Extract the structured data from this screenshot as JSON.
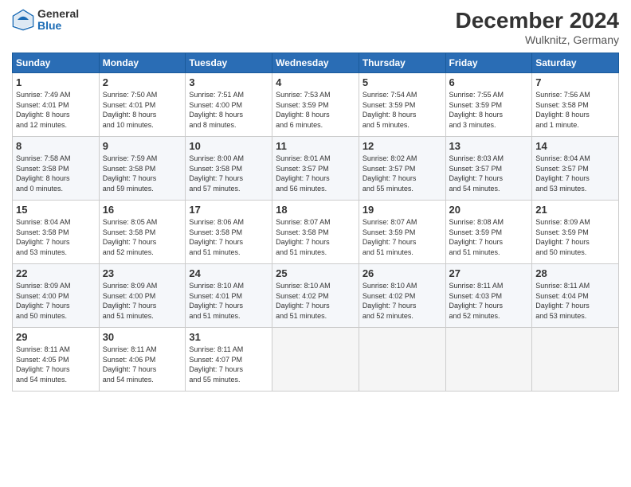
{
  "header": {
    "logo_general": "General",
    "logo_blue": "Blue",
    "month_title": "December 2024",
    "location": "Wulknitz, Germany"
  },
  "weekdays": [
    "Sunday",
    "Monday",
    "Tuesday",
    "Wednesday",
    "Thursday",
    "Friday",
    "Saturday"
  ],
  "weeks": [
    [
      {
        "day": "1",
        "info": "Sunrise: 7:49 AM\nSunset: 4:01 PM\nDaylight: 8 hours\nand 12 minutes."
      },
      {
        "day": "2",
        "info": "Sunrise: 7:50 AM\nSunset: 4:01 PM\nDaylight: 8 hours\nand 10 minutes."
      },
      {
        "day": "3",
        "info": "Sunrise: 7:51 AM\nSunset: 4:00 PM\nDaylight: 8 hours\nand 8 minutes."
      },
      {
        "day": "4",
        "info": "Sunrise: 7:53 AM\nSunset: 3:59 PM\nDaylight: 8 hours\nand 6 minutes."
      },
      {
        "day": "5",
        "info": "Sunrise: 7:54 AM\nSunset: 3:59 PM\nDaylight: 8 hours\nand 5 minutes."
      },
      {
        "day": "6",
        "info": "Sunrise: 7:55 AM\nSunset: 3:59 PM\nDaylight: 8 hours\nand 3 minutes."
      },
      {
        "day": "7",
        "info": "Sunrise: 7:56 AM\nSunset: 3:58 PM\nDaylight: 8 hours\nand 1 minute."
      }
    ],
    [
      {
        "day": "8",
        "info": "Sunrise: 7:58 AM\nSunset: 3:58 PM\nDaylight: 8 hours\nand 0 minutes."
      },
      {
        "day": "9",
        "info": "Sunrise: 7:59 AM\nSunset: 3:58 PM\nDaylight: 7 hours\nand 59 minutes."
      },
      {
        "day": "10",
        "info": "Sunrise: 8:00 AM\nSunset: 3:58 PM\nDaylight: 7 hours\nand 57 minutes."
      },
      {
        "day": "11",
        "info": "Sunrise: 8:01 AM\nSunset: 3:57 PM\nDaylight: 7 hours\nand 56 minutes."
      },
      {
        "day": "12",
        "info": "Sunrise: 8:02 AM\nSunset: 3:57 PM\nDaylight: 7 hours\nand 55 minutes."
      },
      {
        "day": "13",
        "info": "Sunrise: 8:03 AM\nSunset: 3:57 PM\nDaylight: 7 hours\nand 54 minutes."
      },
      {
        "day": "14",
        "info": "Sunrise: 8:04 AM\nSunset: 3:57 PM\nDaylight: 7 hours\nand 53 minutes."
      }
    ],
    [
      {
        "day": "15",
        "info": "Sunrise: 8:04 AM\nSunset: 3:58 PM\nDaylight: 7 hours\nand 53 minutes."
      },
      {
        "day": "16",
        "info": "Sunrise: 8:05 AM\nSunset: 3:58 PM\nDaylight: 7 hours\nand 52 minutes."
      },
      {
        "day": "17",
        "info": "Sunrise: 8:06 AM\nSunset: 3:58 PM\nDaylight: 7 hours\nand 51 minutes."
      },
      {
        "day": "18",
        "info": "Sunrise: 8:07 AM\nSunset: 3:58 PM\nDaylight: 7 hours\nand 51 minutes."
      },
      {
        "day": "19",
        "info": "Sunrise: 8:07 AM\nSunset: 3:59 PM\nDaylight: 7 hours\nand 51 minutes."
      },
      {
        "day": "20",
        "info": "Sunrise: 8:08 AM\nSunset: 3:59 PM\nDaylight: 7 hours\nand 51 minutes."
      },
      {
        "day": "21",
        "info": "Sunrise: 8:09 AM\nSunset: 3:59 PM\nDaylight: 7 hours\nand 50 minutes."
      }
    ],
    [
      {
        "day": "22",
        "info": "Sunrise: 8:09 AM\nSunset: 4:00 PM\nDaylight: 7 hours\nand 50 minutes."
      },
      {
        "day": "23",
        "info": "Sunrise: 8:09 AM\nSunset: 4:00 PM\nDaylight: 7 hours\nand 51 minutes."
      },
      {
        "day": "24",
        "info": "Sunrise: 8:10 AM\nSunset: 4:01 PM\nDaylight: 7 hours\nand 51 minutes."
      },
      {
        "day": "25",
        "info": "Sunrise: 8:10 AM\nSunset: 4:02 PM\nDaylight: 7 hours\nand 51 minutes."
      },
      {
        "day": "26",
        "info": "Sunrise: 8:10 AM\nSunset: 4:02 PM\nDaylight: 7 hours\nand 52 minutes."
      },
      {
        "day": "27",
        "info": "Sunrise: 8:11 AM\nSunset: 4:03 PM\nDaylight: 7 hours\nand 52 minutes."
      },
      {
        "day": "28",
        "info": "Sunrise: 8:11 AM\nSunset: 4:04 PM\nDaylight: 7 hours\nand 53 minutes."
      }
    ],
    [
      {
        "day": "29",
        "info": "Sunrise: 8:11 AM\nSunset: 4:05 PM\nDaylight: 7 hours\nand 54 minutes."
      },
      {
        "day": "30",
        "info": "Sunrise: 8:11 AM\nSunset: 4:06 PM\nDaylight: 7 hours\nand 54 minutes."
      },
      {
        "day": "31",
        "info": "Sunrise: 8:11 AM\nSunset: 4:07 PM\nDaylight: 7 hours\nand 55 minutes."
      },
      {
        "day": "",
        "info": ""
      },
      {
        "day": "",
        "info": ""
      },
      {
        "day": "",
        "info": ""
      },
      {
        "day": "",
        "info": ""
      }
    ]
  ]
}
